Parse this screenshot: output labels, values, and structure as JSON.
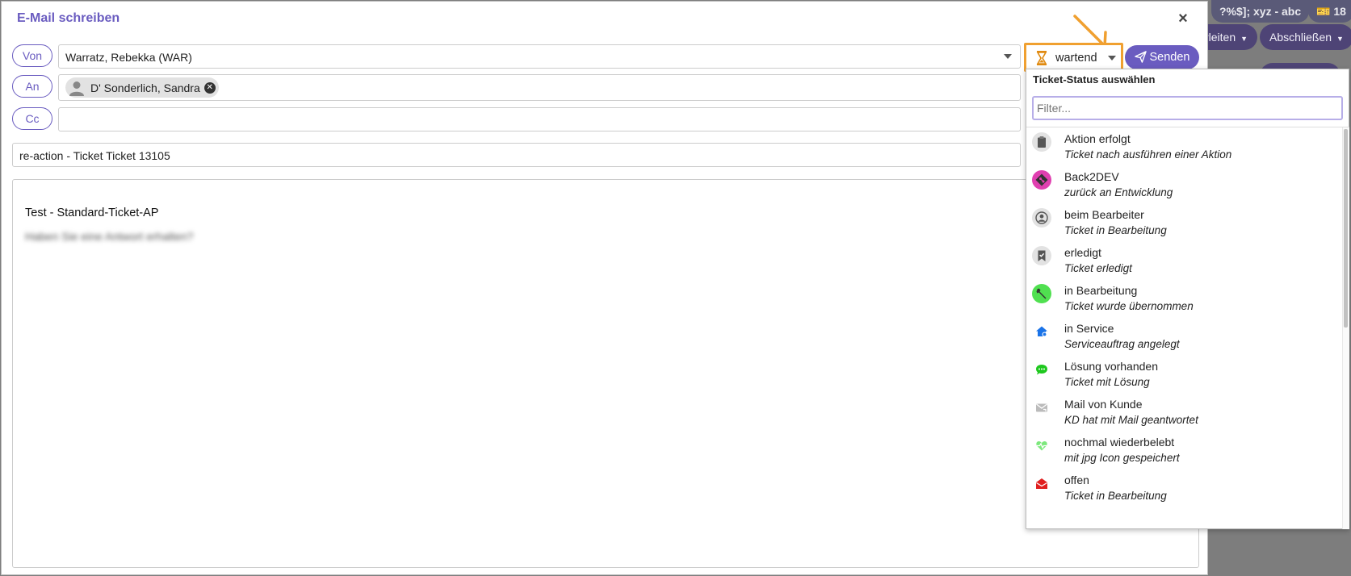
{
  "background": {
    "pill_text": "?%$]; xyz - abc",
    "badge_count": "18",
    "btn_weiterleiten": "rleiten",
    "btn_abschliessen": "Abschließen"
  },
  "dialog": {
    "title": "E-Mail schreiben",
    "close_label": "×",
    "from_label": "Von",
    "from_value": "Warratz, Rebekka (WAR)",
    "to_label": "An",
    "to_recipient": "D' Sonderlich, Sandra",
    "cc_label": "Cc",
    "subject": "re-action - Ticket Ticket 13105",
    "body_line1": "Test - Standard-Ticket-AP",
    "body_line2": "Haben Sie eine Antwort erhalten?"
  },
  "status": {
    "current": "wartend",
    "send_label": "Senden",
    "accent_color": "#f0a030"
  },
  "dropdown": {
    "title": "Ticket-Status auswählen",
    "filter_placeholder": "Filter...",
    "items": [
      {
        "name": "Aktion erfolgt",
        "desc": "Ticket nach ausführen einer Aktion",
        "icon": "clipboard-icon"
      },
      {
        "name": "Back2DEV",
        "desc": "zurück an Entwicklung",
        "icon": "git-diamond-icon"
      },
      {
        "name": "beim Bearbeiter",
        "desc": "Ticket in Bearbeitung",
        "icon": "user-circle-icon"
      },
      {
        "name": "erledigt",
        "desc": "Ticket erledigt",
        "icon": "bookmark-check-icon"
      },
      {
        "name": "in Bearbeitung",
        "desc": "Ticket wurde übernommen",
        "icon": "wrench-icon"
      },
      {
        "name": "in Service",
        "desc": "Serviceauftrag angelegt",
        "icon": "house-gear-icon"
      },
      {
        "name": "Lösung vorhanden",
        "desc": "Ticket mit Lösung",
        "icon": "chat-bubble-icon"
      },
      {
        "name": "Mail von Kunde",
        "desc": "KD hat mit Mail geantwortet",
        "icon": "mail-reply-icon"
      },
      {
        "name": "nochmal wiederbelebt",
        "desc": "mit jpg Icon gespeichert",
        "icon": "heartbeat-icon"
      },
      {
        "name": "offen",
        "desc": "Ticket in Bearbeitung",
        "icon": "open-envelope-icon"
      }
    ]
  }
}
